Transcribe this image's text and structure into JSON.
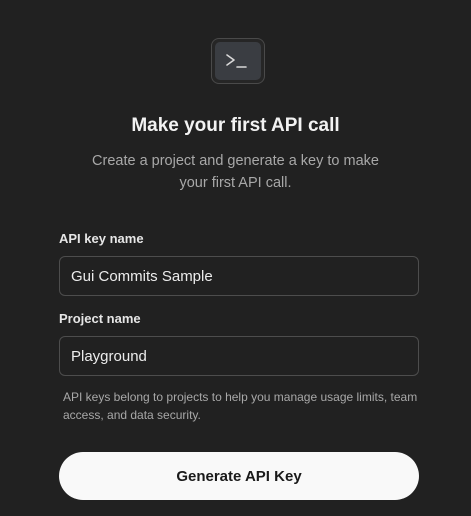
{
  "header": {
    "icon": "terminal-icon",
    "title": "Make your first API call",
    "subtitle": "Create a project and generate a key to make your first API call."
  },
  "form": {
    "api_key_name": {
      "label": "API key name",
      "value": "Gui Commits Sample"
    },
    "project_name": {
      "label": "Project name",
      "value": "Playground"
    },
    "helper_text": "API keys belong to projects to help you manage usage limits, team access, and data security."
  },
  "actions": {
    "generate_label": "Generate API Key"
  }
}
